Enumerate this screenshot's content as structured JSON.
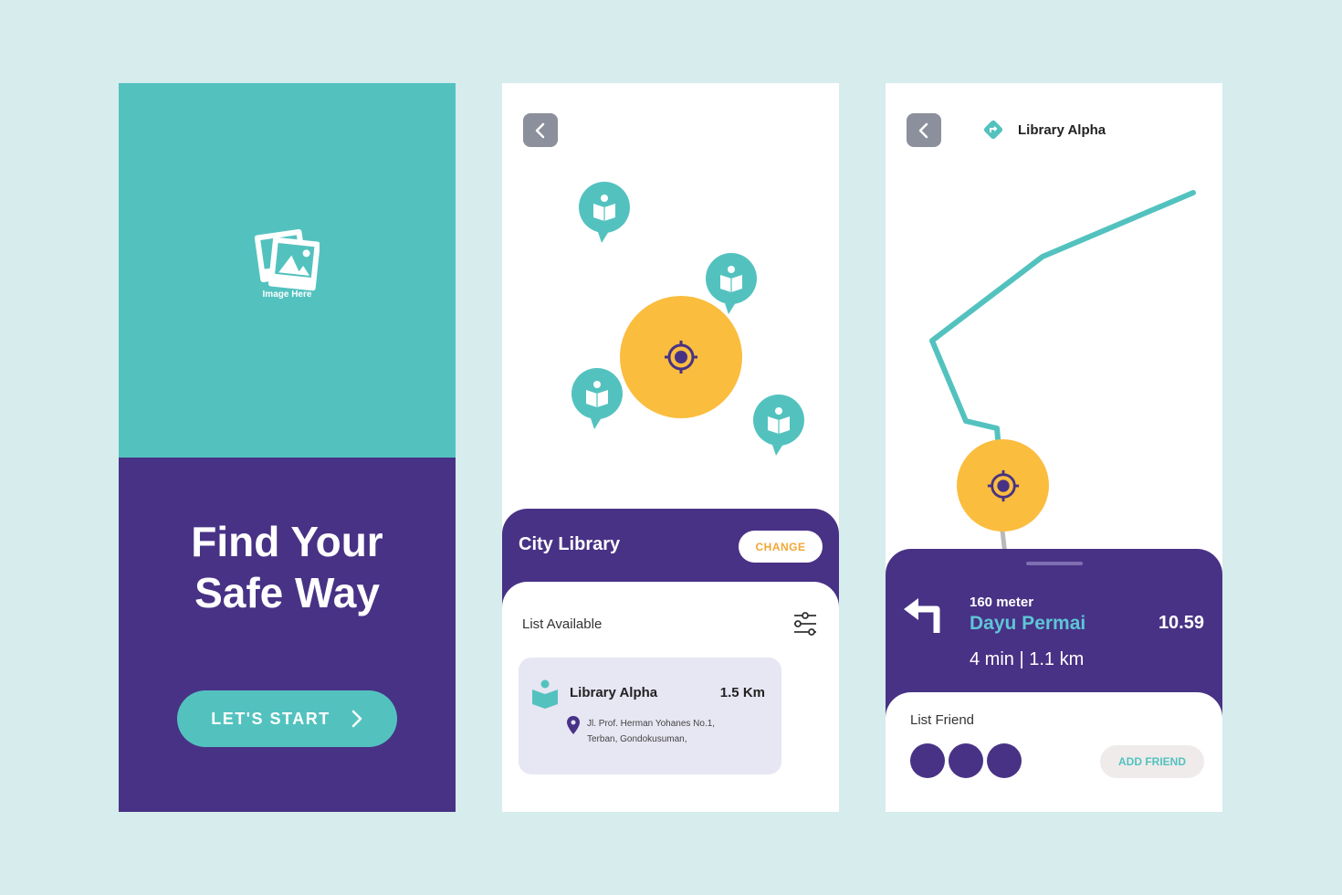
{
  "colors": {
    "background": "#d6eced",
    "teal": "#53c2bf",
    "purple": "#483285",
    "yellow": "#fabd3e",
    "card": "#e7e6f3",
    "back_button": "#8c8f9c",
    "change_text": "#f0a736"
  },
  "screen1": {
    "image_placeholder_label": "Image Here",
    "title_line1": "Find Your",
    "title_line2": "Safe Way",
    "start_button_label": "LET'S START",
    "start_button_icon": "chevron-right-icon"
  },
  "screen2": {
    "back_icon": "chevron-left-icon",
    "map_markers": [
      {
        "icon": "library-pin-icon"
      },
      {
        "icon": "library-pin-icon"
      },
      {
        "icon": "library-pin-icon"
      },
      {
        "icon": "library-pin-icon"
      }
    ],
    "current_location_icon": "crosshair-icon",
    "sheet_title": "City Library",
    "change_button_label": "CHANGE",
    "list_label": "List Available",
    "filter_icon": "sliders-icon",
    "libraries": [
      {
        "name": "Library Alpha",
        "distance": "1.5 Km",
        "address_line1": "Jl. Prof. Herman Yohanes No.1,",
        "address_line2": "Terban, Gondokusuman,"
      }
    ]
  },
  "screen3": {
    "back_icon": "chevron-left-icon",
    "destination_icon": "direction-sign-icon",
    "destination_title": "Library Alpha",
    "navigation": {
      "turn_icon": "turn-left-arrow-icon",
      "distance": "160 meter",
      "street": "Dayu Permai",
      "time": "10.59",
      "eta": "4 min | 1.1 km"
    },
    "friends_label": "List Friend",
    "friends_count": 3,
    "add_friend_label": "ADD FRIEND"
  }
}
